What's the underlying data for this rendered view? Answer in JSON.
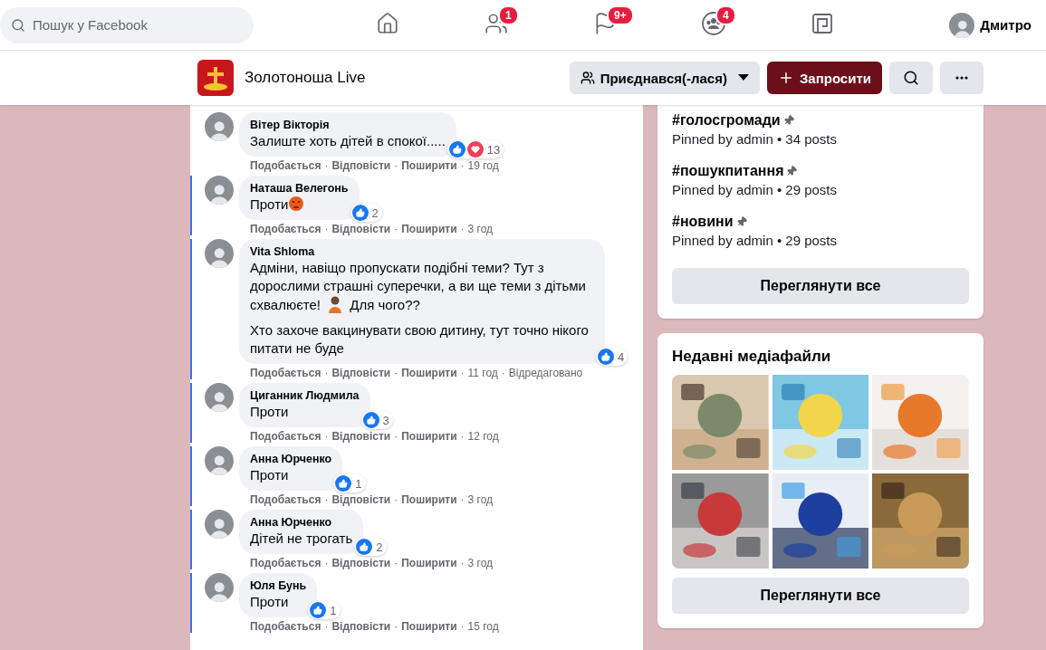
{
  "top_bar": {
    "search": {
      "placeholder": "Пошук у Facebook"
    },
    "nav": [
      {
        "kind": "home",
        "selected": false
      },
      {
        "kind": "friends",
        "badge": "1",
        "selected": false
      },
      {
        "kind": "pages",
        "badge": "9+",
        "selected": false
      },
      {
        "kind": "groups",
        "badge": "4",
        "selected": false
      },
      {
        "kind": "gaming",
        "selected": false
      }
    ],
    "profile": {
      "name": "Дмитро"
    }
  },
  "group_header": {
    "title": "Золотоноша Live",
    "joined_button": "Приєднався(-лася)",
    "invite_button": "Запросити"
  },
  "comments": [
    {
      "author": "Вітер Вікторія",
      "highlighted": false,
      "paragraphs": [
        [
          {
            "kind": "text",
            "text": "Залиште хоть дітей в спокої....."
          }
        ]
      ],
      "reactions": [
        {
          "kind": "like"
        },
        {
          "kind": "love"
        }
      ],
      "count": "13",
      "meta": [
        {
          "kind": "link",
          "text": "Подобається"
        },
        {
          "kind": "separator",
          "text": "·"
        },
        {
          "kind": "link",
          "text": "Відповісти"
        },
        {
          "kind": "separator",
          "text": "·"
        },
        {
          "kind": "link",
          "text": "Поширити"
        },
        {
          "kind": "separator",
          "text": "·"
        },
        {
          "kind": "time",
          "text": "19 год"
        }
      ]
    },
    {
      "author": "Наташа Велегонь",
      "highlighted": true,
      "paragraphs": [
        [
          {
            "kind": "text",
            "text": "Проти"
          },
          {
            "kind": "angry-emoji"
          }
        ]
      ],
      "reactions": [
        {
          "kind": "like"
        }
      ],
      "count": "2",
      "meta": [
        {
          "kind": "link",
          "text": "Подобається"
        },
        {
          "kind": "separator",
          "text": "·"
        },
        {
          "kind": "link",
          "text": "Відповісти"
        },
        {
          "kind": "separator",
          "text": "·"
        },
        {
          "kind": "link",
          "text": "Поширити"
        },
        {
          "kind": "separator",
          "text": "·"
        },
        {
          "kind": "time",
          "text": "3 год"
        }
      ]
    },
    {
      "author": "Vita Shloma",
      "highlighted": true,
      "paragraphs": [
        [
          {
            "kind": "text",
            "text": "Адміни, навіщо пропускати подібні теми? Тут з дорослими страшні суперечки, а ви ще теми з дітьми схвалюєте! "
          },
          {
            "kind": "person-emoji"
          },
          {
            "kind": "text",
            "text": " Для чого??"
          }
        ],
        [
          {
            "kind": "text",
            "text": "Хто захоче вакцинувати свою дитину, тут точно нікого питати не буде"
          }
        ]
      ],
      "reactions": [
        {
          "kind": "like"
        }
      ],
      "count": "4",
      "meta": [
        {
          "kind": "link",
          "text": "Подобається"
        },
        {
          "kind": "separator",
          "text": "·"
        },
        {
          "kind": "link",
          "text": "Відповісти"
        },
        {
          "kind": "separator",
          "text": "·"
        },
        {
          "kind": "link",
          "text": "Поширити"
        },
        {
          "kind": "separator",
          "text": "·"
        },
        {
          "kind": "time",
          "text": "11 год"
        },
        {
          "kind": "separator",
          "text": "·"
        },
        {
          "kind": "edited",
          "text": "Відредаговано"
        }
      ]
    },
    {
      "author": "Циганник Людмила",
      "highlighted": true,
      "paragraphs": [
        [
          {
            "kind": "text",
            "text": "Проти"
          }
        ]
      ],
      "reactions": [
        {
          "kind": "like"
        }
      ],
      "count": "3",
      "meta": [
        {
          "kind": "link",
          "text": "Подобається"
        },
        {
          "kind": "separator",
          "text": "·"
        },
        {
          "kind": "link",
          "text": "Відповісти"
        },
        {
          "kind": "separator",
          "text": "·"
        },
        {
          "kind": "link",
          "text": "Поширити"
        },
        {
          "kind": "separator",
          "text": "·"
        },
        {
          "kind": "time",
          "text": "12 год"
        }
      ]
    },
    {
      "author": "Анна Юрченко",
      "highlighted": true,
      "paragraphs": [
        [
          {
            "kind": "text",
            "text": "Проти"
          }
        ]
      ],
      "reactions": [
        {
          "kind": "like"
        }
      ],
      "count": "1",
      "meta": [
        {
          "kind": "link",
          "text": "Подобається"
        },
        {
          "kind": "separator",
          "text": "·"
        },
        {
          "kind": "link",
          "text": "Відповісти"
        },
        {
          "kind": "separator",
          "text": "·"
        },
        {
          "kind": "link",
          "text": "Поширити"
        },
        {
          "kind": "separator",
          "text": "·"
        },
        {
          "kind": "time",
          "text": "3 год"
        }
      ]
    },
    {
      "author": "Анна Юрченко",
      "highlighted": true,
      "paragraphs": [
        [
          {
            "kind": "text",
            "text": "Дітей не трогать"
          }
        ]
      ],
      "reactions": [
        {
          "kind": "like"
        }
      ],
      "count": "2",
      "meta": [
        {
          "kind": "link",
          "text": "Подобається"
        },
        {
          "kind": "separator",
          "text": "·"
        },
        {
          "kind": "link",
          "text": "Відповісти"
        },
        {
          "kind": "separator",
          "text": "·"
        },
        {
          "kind": "link",
          "text": "Поширити"
        },
        {
          "kind": "separator",
          "text": "·"
        },
        {
          "kind": "time",
          "text": "3 год"
        }
      ]
    },
    {
      "author": "Юля Бунь",
      "highlighted": true,
      "paragraphs": [
        [
          {
            "kind": "text",
            "text": "Проти"
          }
        ]
      ],
      "reactions": [
        {
          "kind": "like"
        }
      ],
      "count": "1",
      "meta": [
        {
          "kind": "link",
          "text": "Подобається"
        },
        {
          "kind": "separator",
          "text": "·"
        },
        {
          "kind": "link",
          "text": "Відповісти"
        },
        {
          "kind": "separator",
          "text": "·"
        },
        {
          "kind": "link",
          "text": "Поширити"
        },
        {
          "kind": "separator",
          "text": "·"
        },
        {
          "kind": "time",
          "text": "15 год"
        }
      ]
    }
  ],
  "topics": {
    "items": [
      {
        "tag": "#голосгромади",
        "pinned": true,
        "meta": "Pinned by admin • 34 posts"
      },
      {
        "tag": "#пошукпитання",
        "pinned": true,
        "meta": "Pinned by admin • 29 posts"
      },
      {
        "tag": "#новини",
        "pinned": true,
        "meta": "Pinned by admin • 29 posts"
      }
    ],
    "button": "Переглянути все"
  },
  "media": {
    "title": "Недавні медіафайли",
    "button": "Переглянути все"
  }
}
